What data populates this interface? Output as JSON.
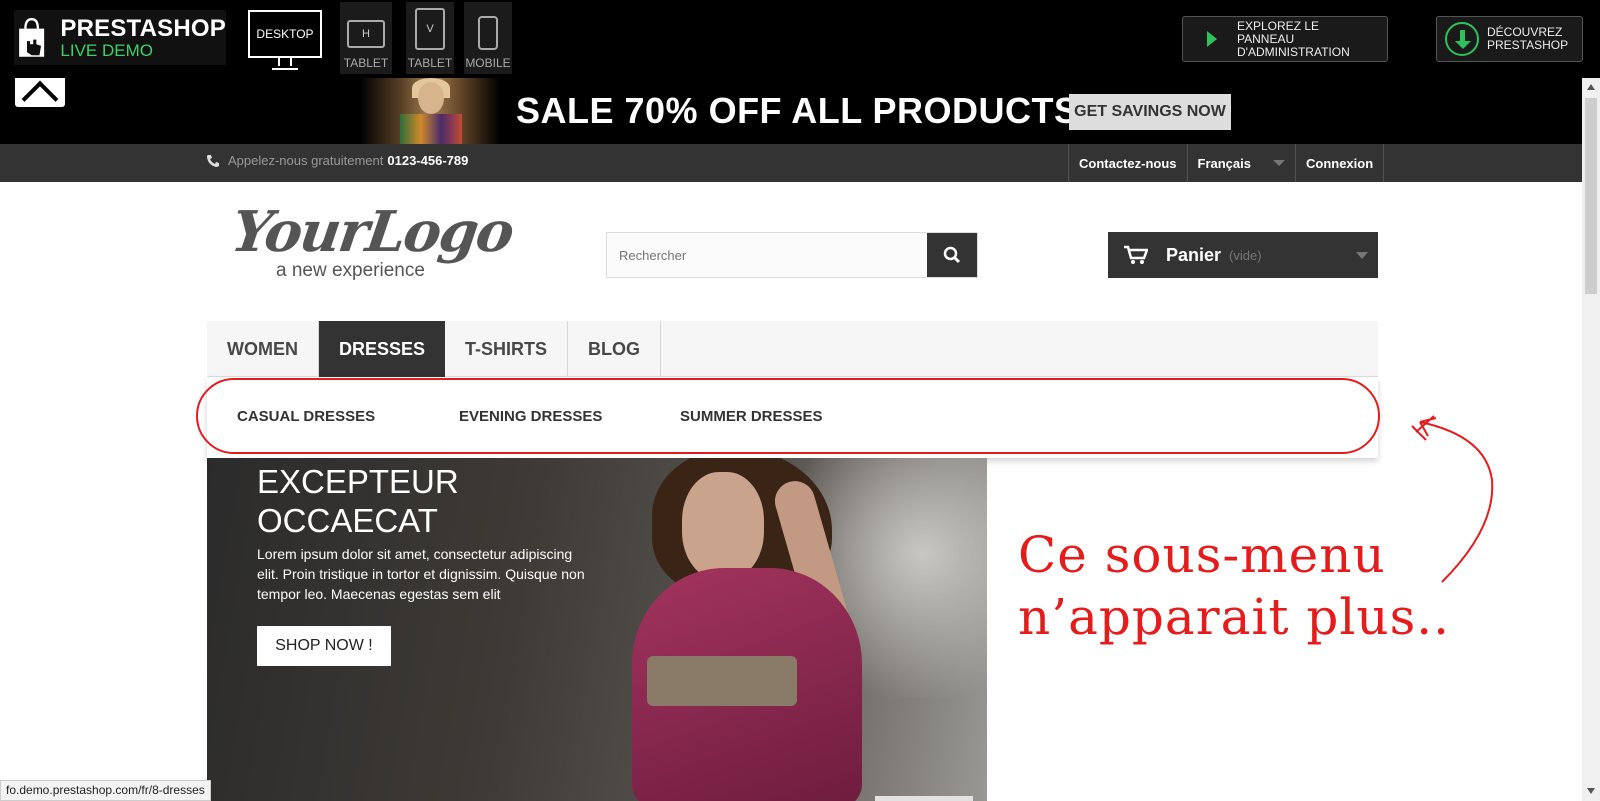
{
  "demo_bar": {
    "brand": "PRESTASHOP",
    "brand_sub": "LIVE DEMO",
    "devices": [
      {
        "label": "DESKTOP",
        "glyph": ""
      },
      {
        "label": "TABLET",
        "glyph": "H"
      },
      {
        "label": "TABLET",
        "glyph": "V"
      },
      {
        "label": "MOBILE",
        "glyph": ""
      }
    ],
    "explore_label_1": "EXPLOREZ LE",
    "explore_label_2": "PANNEAU D'ADMINISTRATION",
    "discover_label_1": "DÉCOUVREZ",
    "discover_label_2": "PRESTASHOP",
    "accent": "#2ec25d"
  },
  "sale_banner": {
    "text": "SALE 70% OFF ALL PRODUCTS",
    "button": "GET SAVINGS NOW"
  },
  "nav": {
    "phone_label": "Appelez-nous gratuitement",
    "phone_number": "0123-456-789",
    "contact": "Contactez-nous",
    "language": "Français",
    "login": "Connexion"
  },
  "header": {
    "logo_main": "YourLogo",
    "logo_tagline": "a new experience",
    "search_placeholder": "Rechercher",
    "cart_label": "Panier",
    "cart_status": "(vide)"
  },
  "menu": {
    "items": [
      "WOMEN",
      "DRESSES",
      "T-SHIRTS",
      "BLOG"
    ],
    "active": "DRESSES",
    "submenu": [
      "CASUAL DRESSES",
      "EVENING DRESSES",
      "SUMMER DRESSES"
    ]
  },
  "slide": {
    "title": "EXCEPTEUR OCCAECAT",
    "body": "Lorem ipsum dolor sit amet, consectetur adipiscing elit. Proin tristique in tortor et dignissim. Quisque non tempor leo. Maecenas egestas sem elit",
    "button": "SHOP NOW !"
  },
  "annotation": {
    "line1": "Ce sous-menu",
    "line2": "n’apparait plus..",
    "color": "#e51c1c"
  },
  "status_url": "fo.demo.prestashop.com/fr/8-dresses"
}
